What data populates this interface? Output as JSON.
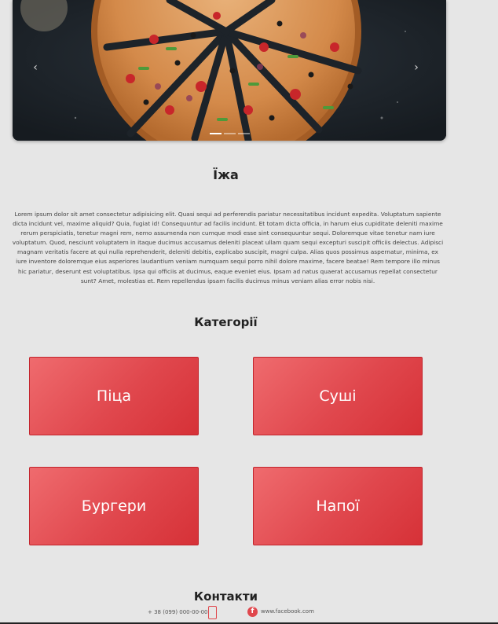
{
  "carousel": {
    "prev_glyph": "‹",
    "next_glyph": "›",
    "slide_count": 3,
    "active_slide": 1
  },
  "food": {
    "title": "Їжа",
    "description": "Lorem ipsum dolor sit amet consectetur adipisicing elit. Quasi sequi ad perferendis pariatur necessitatibus incidunt expedita. Voluptatum sapiente dicta incidunt vel, maxime aliquid? Quia, fugiat id! Consequuntur ad facilis incidunt. Et totam dicta officia, in harum eius cupiditate deleniti maxime rerum perspiciatis, tenetur magni rem, nemo assumenda non cumque modi esse sint consequuntur sequi. Doloremque vitae tenetur nam iure voluptatum. Quod, nesciunt voluptatem in itaque ducimus accusamus deleniti placeat ullam quam sequi excepturi suscipit officiis delectus. Adipisci magnam veritatis facere at qui nulla reprehenderit, deleniti debitis, explicabo suscipit, magni culpa. Alias quos possimus aspernatur, minima, ex iure inventore doloremque eius asperiores laudantium veniam numquam sequi porro nihil dolore maxime, facere beatae! Rem tempore illo minus hic pariatur, deserunt est voluptatibus. Ipsa qui officiis at ducimus, eaque eveniet eius. Ipsam ad natus quaerat accusamus repellat consectetur sunt? Amet, molestias et. Rem repellendus ipsam facilis ducimus minus veniam alias error nobis nisi."
  },
  "categories": {
    "title": "Категорії",
    "items": [
      {
        "label": "Піца"
      },
      {
        "label": "Суші"
      },
      {
        "label": "Бургери"
      },
      {
        "label": "Напої"
      }
    ]
  },
  "contacts": {
    "title": "Контакти",
    "phone": "+ 38 (099) 000-00-00",
    "facebook": "www.facebook.com",
    "phone_icon": "phone-icon",
    "facebook_icon": "facebook-icon"
  },
  "colors": {
    "accent": "#e0474d",
    "background": "#e6e6e6"
  }
}
